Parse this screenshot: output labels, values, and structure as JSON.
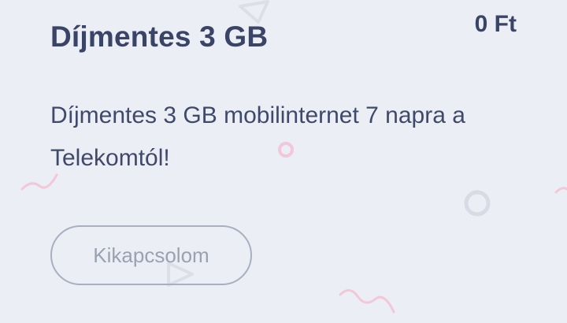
{
  "offer": {
    "title": "Díjmentes 3 GB",
    "price": "0 Ft",
    "description": "Díjmentes 3 GB mobilinternet 7 napra a Telekomtól!"
  },
  "actions": {
    "deactivate_label": "Kikapcsolom"
  },
  "colors": {
    "background": "#eceef5",
    "text_primary": "#3a4466",
    "button_border": "#a8afc0",
    "button_text": "#9aa1b1",
    "decor_pink": "#f2c7d8",
    "decor_gray": "#d8dbe5"
  }
}
